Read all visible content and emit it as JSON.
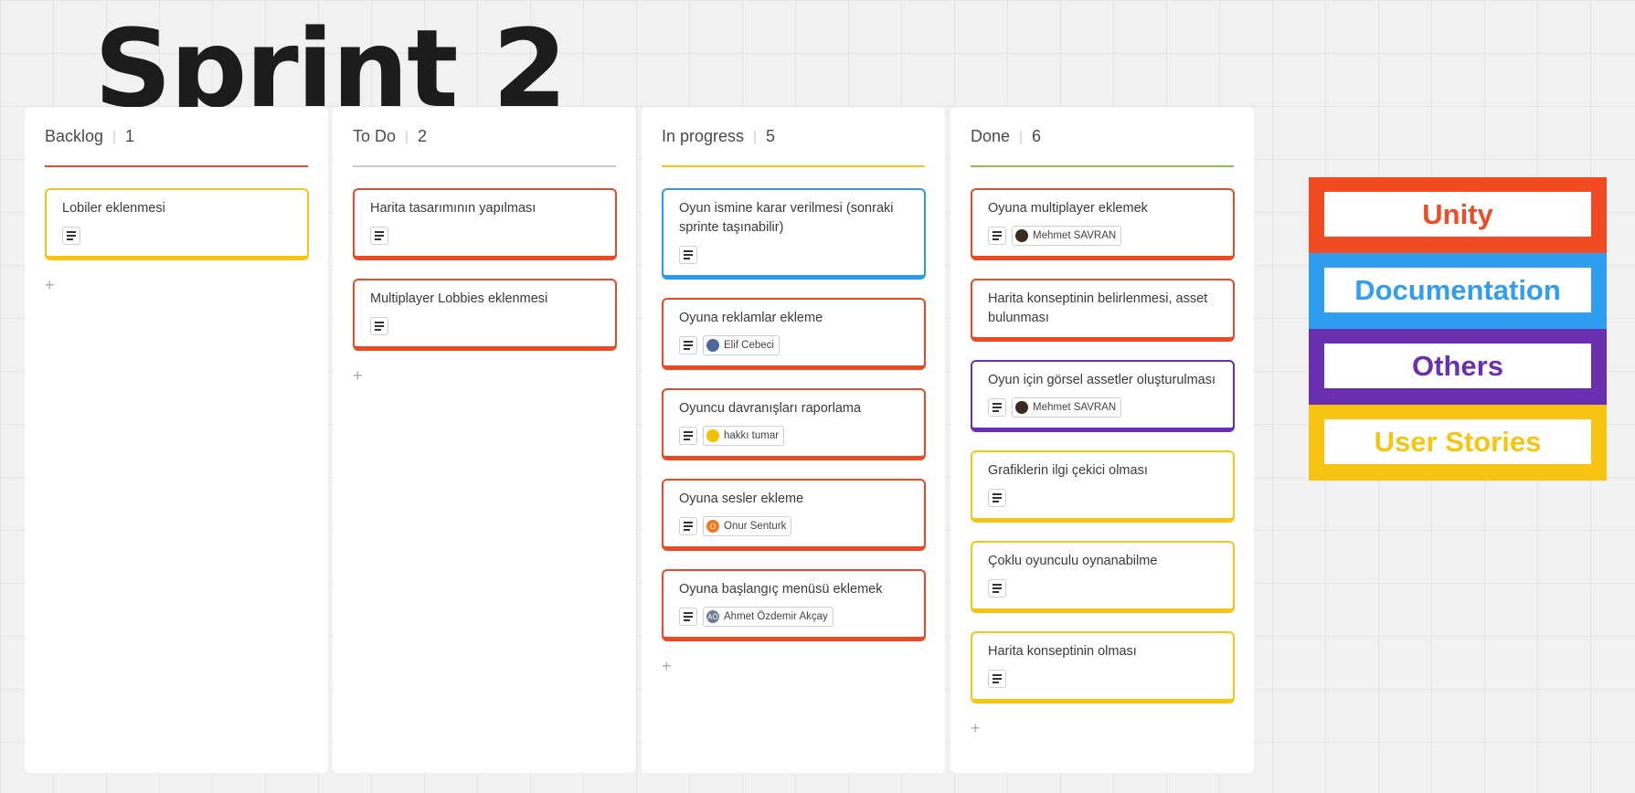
{
  "title": "Sprint 2",
  "columns": [
    {
      "name": "Backlog",
      "count": "1",
      "line_color": "#e94a25",
      "cards": [
        {
          "title": "Lobiler eklenmesi",
          "color": "#f7c511",
          "assignee": null
        }
      ]
    },
    {
      "name": "To Do",
      "count": "2",
      "line_color": "#cccccc",
      "cards": [
        {
          "title": "Harita tasarımının yapılması",
          "color": "#e94a25",
          "assignee": null
        },
        {
          "title": "Multiplayer Lobbies eklenmesi",
          "color": "#e94a25",
          "assignee": null
        }
      ]
    },
    {
      "name": "In progress",
      "count": "5",
      "line_color": "#f7c511",
      "cards": [
        {
          "title": "Oyun ismine karar verilmesi (sonraki sprinte taşınabilir)",
          "color": "#2b9ced",
          "assignee": null
        },
        {
          "title": "Oyuna reklamlar ekleme",
          "color": "#e94a25",
          "assignee": "Elif Cebeci",
          "avatar_color": "#4a6a9a",
          "avatar_text": ""
        },
        {
          "title": "Oyuncu davranışları raporlama",
          "color": "#e94a25",
          "assignee": "hakkı tumar",
          "avatar_color": "#f2c100",
          "avatar_text": ""
        },
        {
          "title": "Oyuna sesler ekleme",
          "color": "#e94a25",
          "assignee": "Onur Senturk",
          "avatar_color": "#f07a1a",
          "avatar_text": "O"
        },
        {
          "title": "Oyuna başlangıç menüsü eklemek",
          "color": "#e94a25",
          "assignee": "Ahmet Özdemir Akçay",
          "avatar_color": "#6c7a94",
          "avatar_text": "AÖ"
        }
      ]
    },
    {
      "name": "Done",
      "count": "6",
      "line_color": "#8bc34a",
      "cards": [
        {
          "title": "Oyuna multiplayer eklemek",
          "color": "#e94a25",
          "assignee": "Mehmet SAVRAN",
          "avatar_color": "#3a2a20",
          "avatar_text": ""
        },
        {
          "title": "Harita konseptinin belirlenmesi, asset bulunması",
          "color": "#e94a25",
          "assignee": null,
          "no_meta": true
        },
        {
          "title": "Oyun için görsel assetler oluşturulması",
          "color": "#6a2fb0",
          "assignee": "Mehmet SAVRAN",
          "avatar_color": "#3a2a20",
          "avatar_text": ""
        },
        {
          "title": "Grafiklerin ilgi çekici olması",
          "color": "#f7c511",
          "assignee": null
        },
        {
          "title": "Çoklu oyunculu oynanabilme",
          "color": "#f7c511",
          "assignee": null
        },
        {
          "title": "Harita konseptinin olması",
          "color": "#f7c511",
          "assignee": null
        }
      ]
    }
  ],
  "add_label": "+",
  "legend": [
    {
      "label": "Unity",
      "color": "#f04b23"
    },
    {
      "label": "Documentation",
      "color": "#2f9ef0"
    },
    {
      "label": "Others",
      "color": "#6a2fb0"
    },
    {
      "label": "User Stories",
      "color": "#f7c511"
    }
  ]
}
